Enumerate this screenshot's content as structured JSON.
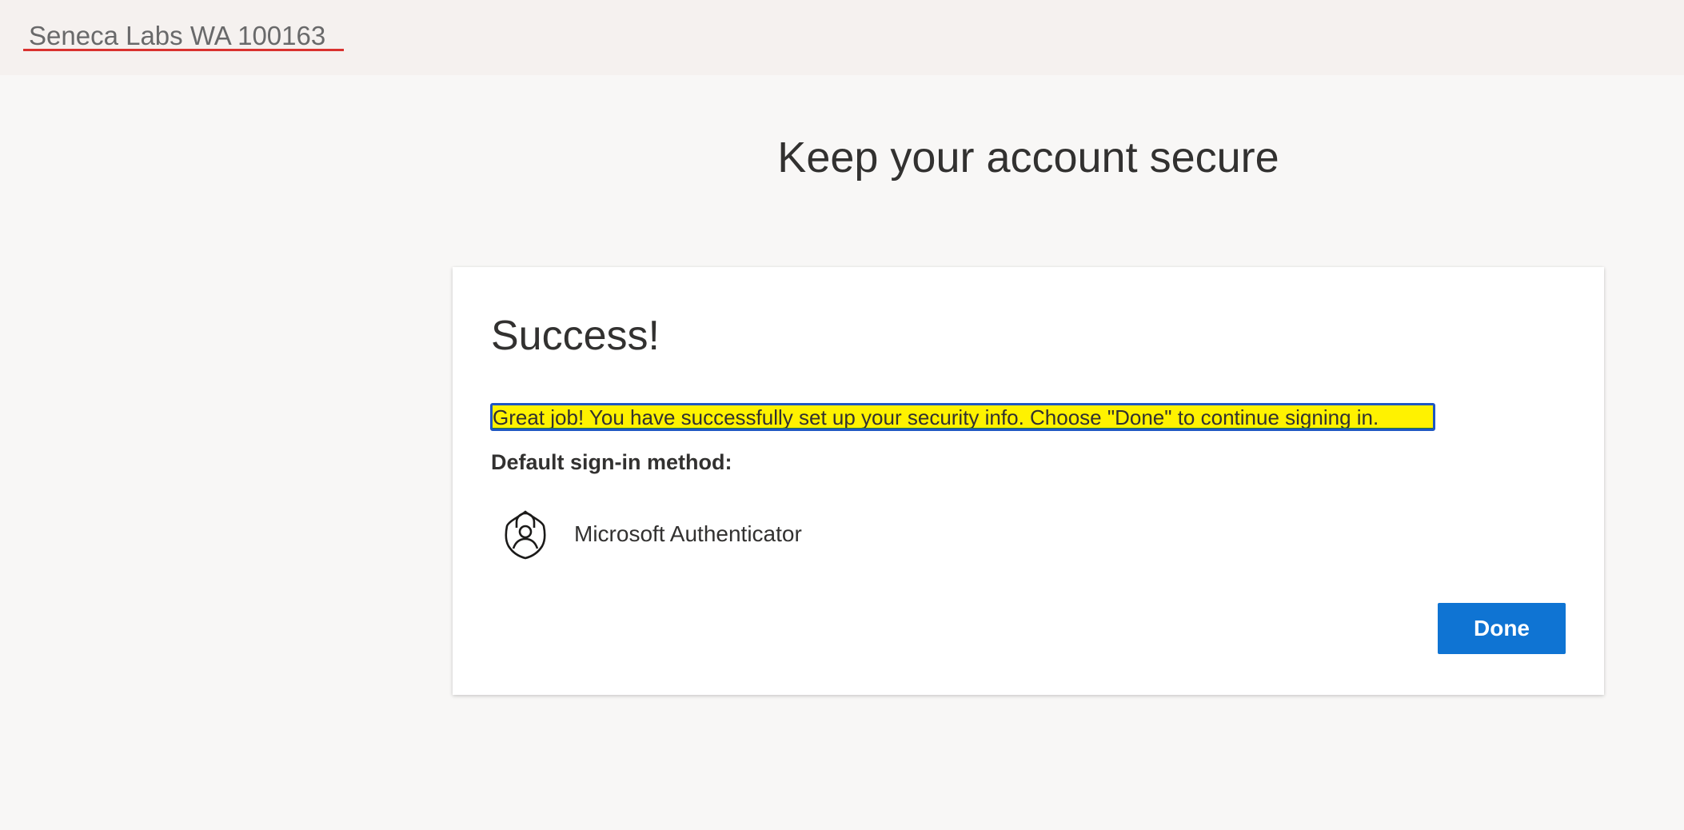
{
  "header": {
    "org_name": "Seneca Labs WA 100163"
  },
  "page": {
    "title": "Keep your account secure"
  },
  "card": {
    "title": "Success!",
    "message": "Great job! You have successfully set up your security info. Choose \"Done\" to continue signing in.",
    "default_method_label": "Default sign-in method:",
    "method": {
      "icon": "authenticator-lock-icon",
      "label": "Microsoft Authenticator"
    },
    "done_label": "Done"
  },
  "colors": {
    "accent": "#0f74d3",
    "highlight": "#fff200",
    "focus_border": "#1f57c3",
    "org_underline": "#d9322f",
    "header_bg": "#f5f1ef",
    "page_bg": "#f8f7f6"
  }
}
